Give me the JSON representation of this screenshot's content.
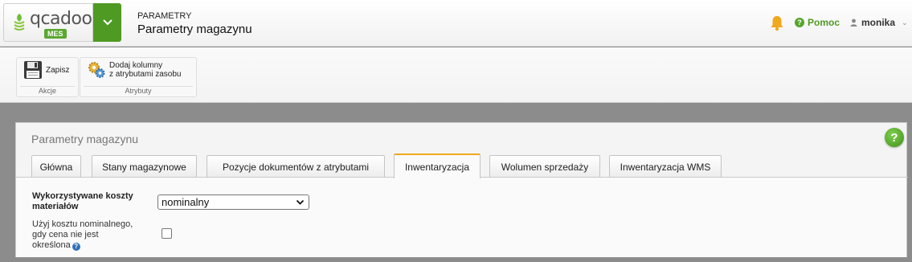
{
  "header": {
    "logo_text": "qcadoo",
    "logo_badge": "MES",
    "breadcrumb_top": "PARAMETRY",
    "page_title": "Parametry magazynu",
    "help_label": "Pomoc",
    "user_name": "monika",
    "icons": {
      "menu": "chevron-down-icon",
      "notifications": "bell-icon",
      "help": "help-icon",
      "user": "user-icon"
    }
  },
  "ribbon": {
    "groups": [
      {
        "name": "Akcje",
        "buttons": [
          {
            "label": "Zapisz",
            "icon": "floppy-disk-icon"
          }
        ]
      },
      {
        "name": "Atrybuty",
        "buttons": [
          {
            "label_line1": "Dodaj kolumny",
            "label_line2": "z atrybutami zasobu",
            "icon": "gears-icon"
          }
        ]
      }
    ]
  },
  "panel": {
    "title": "Parametry magazynu",
    "tabs": [
      {
        "label": "Główna"
      },
      {
        "label": "Stany magazynowe"
      },
      {
        "label": "Pozycje dokumentów z atrybutami"
      },
      {
        "label": "Inwentaryzacja",
        "active": true
      },
      {
        "label": "Wolumen sprzedaży"
      },
      {
        "label": "Inwentaryzacja WMS"
      }
    ],
    "form": {
      "cost_label_line1": "Wykorzystywane koszty",
      "cost_label_line2": "materiałów",
      "cost_value": "nominalny",
      "nominal_label_line1": "Użyj kosztu nominalnego,",
      "nominal_label_line2": "gdy cena nie jest",
      "nominal_label_line3": "określona",
      "nominal_checked": false
    }
  },
  "colors": {
    "brand_green": "#4f9a22",
    "active_tab_accent": "#f0a81c",
    "bell": "#f0a81c",
    "info_blue": "#2e6fb8"
  }
}
